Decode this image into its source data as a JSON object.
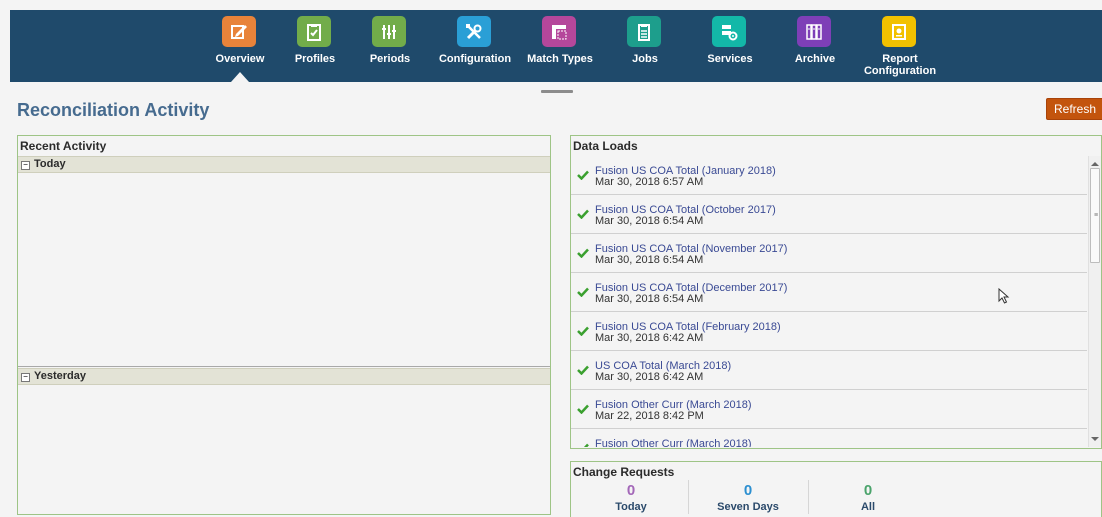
{
  "nav": [
    {
      "label": "Overview",
      "color": "#e8833a",
      "icon": "overview-icon",
      "active": true
    },
    {
      "label": "Profiles",
      "color": "#72ac4a",
      "icon": "profiles-icon"
    },
    {
      "label": "Periods",
      "color": "#72ac4a",
      "icon": "periods-icon"
    },
    {
      "label": "Configuration",
      "color": "#2a9fd6",
      "icon": "tools-icon"
    },
    {
      "label": "Match Types",
      "color": "#b5479b",
      "icon": "match-types-icon"
    },
    {
      "label": "Jobs",
      "color": "#1d9e8c",
      "icon": "jobs-icon"
    },
    {
      "label": "Services",
      "color": "#13b8a8",
      "icon": "services-icon"
    },
    {
      "label": "Archive",
      "color": "#7e3fb7",
      "icon": "archive-icon"
    },
    {
      "label": "Report\nConfiguration",
      "color": "#f2c100",
      "icon": "report-configuration-icon"
    }
  ],
  "page": {
    "title": "Reconciliation Activity",
    "refresh_label": "Refresh"
  },
  "recent_activity": {
    "title": "Recent Activity",
    "groups": {
      "today": "Today",
      "yesterday": "Yesterday"
    }
  },
  "data_loads": {
    "title": "Data Loads",
    "items": [
      {
        "name": "Fusion US COA Total (January 2018)",
        "date": "Mar 30, 2018 6:57 AM"
      },
      {
        "name": "Fusion US COA Total (October 2017)",
        "date": "Mar 30, 2018 6:54 AM"
      },
      {
        "name": "Fusion US COA Total (November 2017)",
        "date": "Mar 30, 2018 6:54 AM"
      },
      {
        "name": "Fusion US COA Total (December 2017)",
        "date": "Mar 30, 2018 6:54 AM"
      },
      {
        "name": "Fusion US COA Total (February 2018)",
        "date": "Mar 30, 2018 6:42 AM"
      },
      {
        "name": "US COA Total (March 2018)",
        "date": "Mar 30, 2018 6:42 AM"
      },
      {
        "name": "Fusion Other Curr (March 2018)",
        "date": "Mar 22, 2018 8:42 PM"
      },
      {
        "name": "Fusion Other Curr (March 2018)",
        "date": ""
      }
    ]
  },
  "change_requests": {
    "title": "Change Requests",
    "stats": [
      {
        "count": "0",
        "label": "Today",
        "color": "#a367b8"
      },
      {
        "count": "0",
        "label": "Seven Days",
        "color": "#2c8fd0"
      },
      {
        "count": "0",
        "label": "All",
        "color": "#4aa36b"
      }
    ]
  }
}
